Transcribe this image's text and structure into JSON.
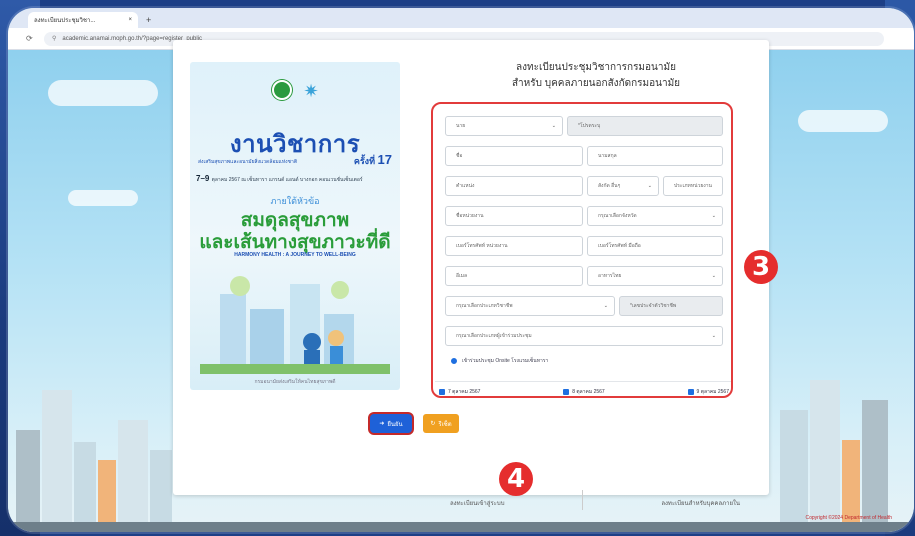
{
  "browser": {
    "tab_title": "ลงทะเบียนประชุมวิชา...",
    "tab_close": "×",
    "new_tab": "+",
    "url": "academic.anamai.moph.go.th/?page=register_public",
    "back_icon": "back-arrow-icon",
    "reload_icon": "reload-icon"
  },
  "poster": {
    "title": "งานวิชาการ",
    "subtitle": "ส่งเสริมสุขภาพและอนามัยสิ่งแวดล้อมแห่งชาติ",
    "edition_prefix": "ครั้งที่",
    "edition_number": "17",
    "date_main": "7–9",
    "date_detail": "ตุลาคม 2567 ณ เซ็นทารา แกรนด์ แอนด์ บางกอก คอนเวนชั่นเซ็นเตอร์",
    "theme_label": "ภายใต้หัวข้อ",
    "theme_line1": "สมดุลสุขภาพ",
    "theme_line2": "และเส้นทางสุขภาวะที่ดี",
    "theme_en": "HARMONY HEALTH : A JOURNEY TO WELL-BEING",
    "caption": "กรมอนามัยส่งเสริมให้คนไทยสุขภาพดี"
  },
  "form": {
    "heading_line1": "ลงทะเบียนประชุมวิชาการกรมอนามัย",
    "heading_line2": "สำหรับ บุคคลภายนอกสังกัดกรมอนามัย",
    "prefix_select": "นาย",
    "prefix_other_placeholder": "*โปรดระบุ",
    "first_name_placeholder": "ชื่อ",
    "last_name_placeholder": "นามสกุล",
    "position_placeholder": "ตำแหน่ง",
    "org_affiliation_select": "สังกัด อื่นๆ",
    "org_type_placeholder": "ประเภทหน่วยงาน",
    "org_name_placeholder": "ชื่อหน่วยงาน",
    "province_select": "กรุณาเลือกจังหวัด",
    "org_phone_placeholder": "เบอร์โทรศัพท์ หน่วยงาน",
    "mobile_placeholder": "เบอร์โทรศัพท์ มือถือ",
    "email_placeholder": "อีเมล",
    "food_select": "อาหารไทย",
    "profession_select": "กรุณาเลือกประเภทวิชาชีพ",
    "license_placeholder": "*เลขประจำตัววิชาชีพ",
    "attendee_type_select": "กรุณาเลือกประเภทผู้เข้าร่วมประชุม",
    "radio_label": "เข้าร่วมประชุม Onsite โรงแรมเซ็นทารา",
    "check_day1": "7 ตุลาคม 2567",
    "check_day2": "8 ตุลาคม 2567",
    "check_day3": "9 ตุลาคม 2567"
  },
  "buttons": {
    "confirm": "ยืนยัน",
    "reset": "รีเซ็ต",
    "confirm_icon": "save-icon",
    "reset_icon": "refresh-icon"
  },
  "links": {
    "login": "ลงทะเบียนเข้าสู่ระบบ",
    "external": "ลงทะเบียนสำหรับบุคคลภายใน"
  },
  "markers": {
    "step3": "3",
    "step4": "4"
  },
  "footer": {
    "copyright": "Copyright ©2024 Department of Health"
  },
  "colors": {
    "accent_red": "#e23b3b",
    "primary_blue": "#1e61d8",
    "reset_orange": "#f0a020"
  }
}
